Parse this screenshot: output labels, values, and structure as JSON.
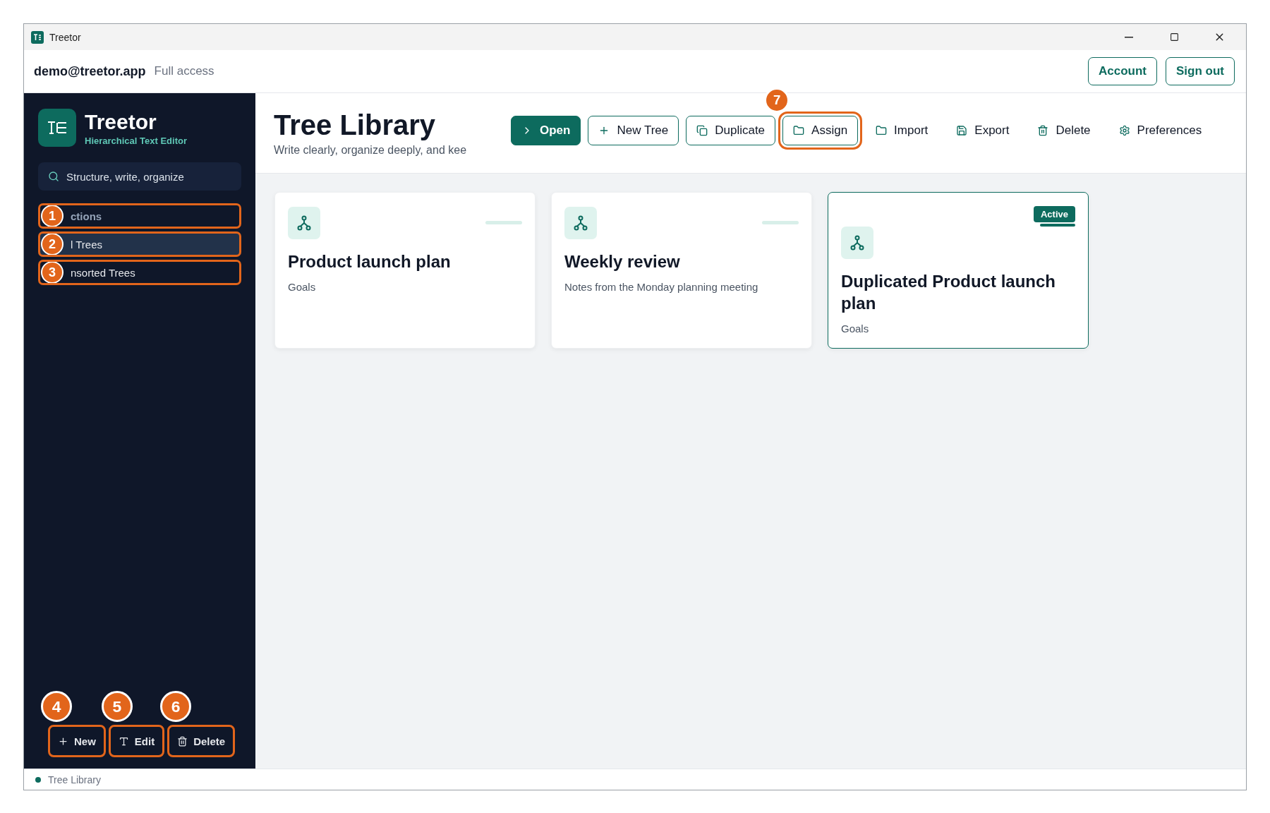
{
  "window": {
    "title": "Treetor"
  },
  "header": {
    "user": "demo@treetor.app",
    "access": "Full access",
    "buttons": [
      "Account",
      "Sign out"
    ]
  },
  "sidebar": {
    "app_name": "Treetor",
    "tagline": "Hierarchical Text Editor",
    "search": {
      "placeholder": "Structure, write, organize"
    },
    "items": [
      {
        "label": "ctions",
        "kind": "heading",
        "selected": false,
        "callout": "1"
      },
      {
        "label": "l Trees",
        "kind": "item",
        "selected": true,
        "callout": "2"
      },
      {
        "label": "nsorted Trees",
        "kind": "item",
        "selected": false,
        "callout": "3"
      }
    ],
    "actions": [
      {
        "label": "New",
        "callout": "4"
      },
      {
        "label": "Edit",
        "callout": "5"
      },
      {
        "label": "Delete",
        "callout": "6"
      }
    ]
  },
  "page": {
    "title": "Tree Library",
    "subtitle": "Write clearly, organize deeply, and kee"
  },
  "toolbar": [
    {
      "label": "Open",
      "kind": "primary"
    },
    {
      "label": "New Tree",
      "kind": "outline"
    },
    {
      "label": "Duplicate",
      "kind": "outline"
    },
    {
      "label": "Assign",
      "kind": "outline",
      "callout": "7"
    },
    {
      "label": "Import",
      "kind": "plain"
    },
    {
      "label": "Export",
      "kind": "plain"
    },
    {
      "label": "Delete",
      "kind": "plain"
    },
    {
      "label": "Preferences",
      "kind": "plain"
    }
  ],
  "cards": [
    {
      "title": "Product launch plan",
      "subtitle": "Goals",
      "selected": false
    },
    {
      "title": "Weekly review",
      "subtitle": "Notes from the Monday planning meeting",
      "selected": false
    },
    {
      "title": "Duplicated Product launch plan",
      "subtitle": "Goals",
      "selected": true,
      "badge": "Active"
    }
  ],
  "status_bar": {
    "text": "Tree Library"
  }
}
